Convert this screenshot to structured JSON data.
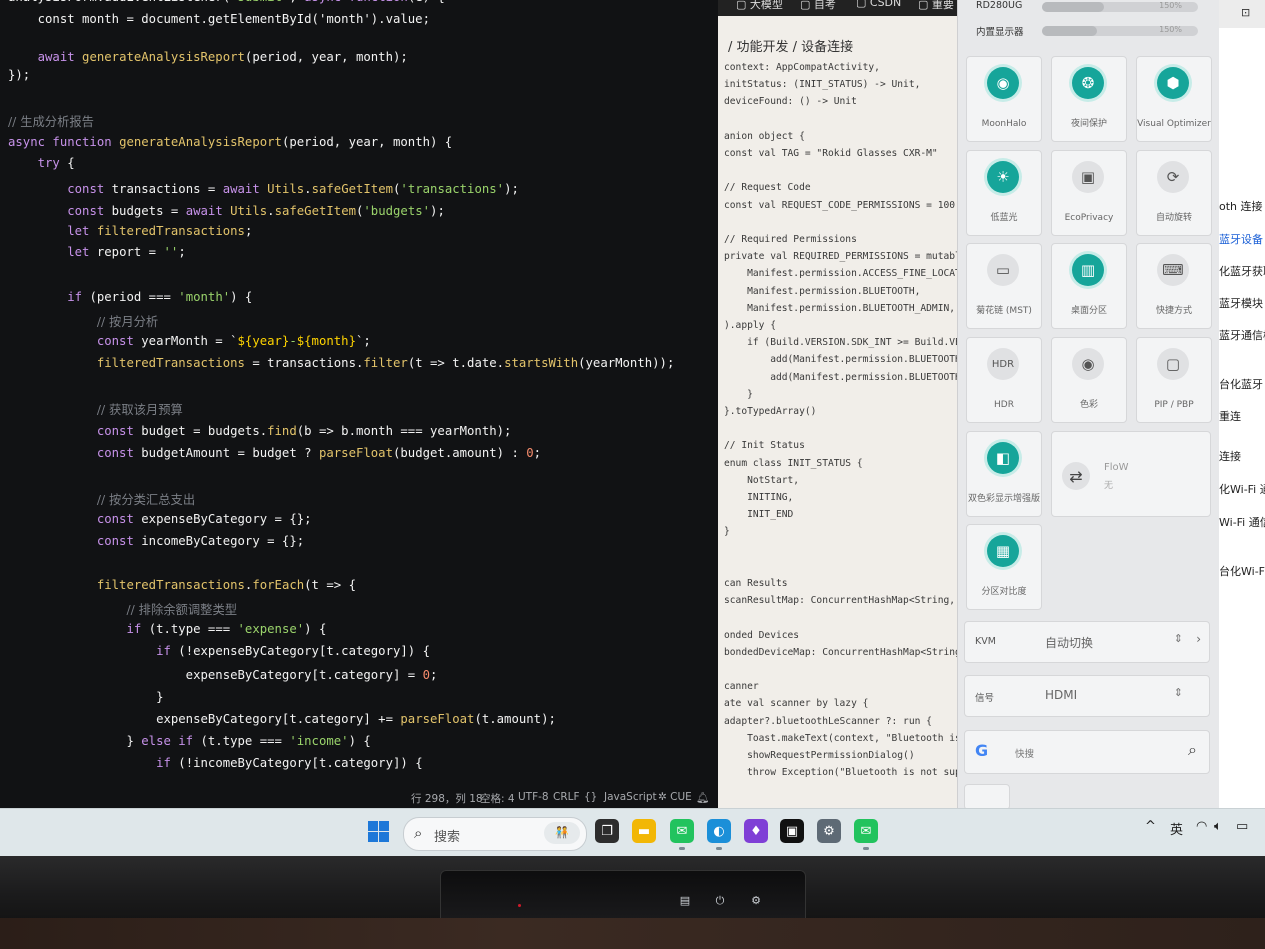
{
  "editor": {
    "lines": [
      {
        "tokens": [
          [
            "pr",
            "analysisForm.addEventListener("
          ],
          [
            "str",
            "'submit'"
          ],
          [
            "pr",
            ", "
          ],
          [
            "kw",
            "async function"
          ],
          [
            "pr",
            "(e) {"
          ]
        ]
      },
      {
        "tokens": [
          [
            "pr",
            "    const month = document.getElementById('month').value;"
          ]
        ]
      },
      {
        "tokens": []
      },
      {
        "tokens": [
          [
            "pr",
            "    "
          ],
          [
            "kw",
            "await "
          ],
          [
            "fn",
            "generateAnalysisReport"
          ],
          [
            "pr",
            "(period, year, month);"
          ]
        ]
      },
      {
        "tokens": [
          [
            "pr",
            "});"
          ]
        ]
      },
      {
        "tokens": []
      },
      {
        "tokens": [
          [
            "cm",
            "// 生成分析报告"
          ]
        ]
      },
      {
        "tokens": [
          [
            "kw",
            "async function "
          ],
          [
            "fn",
            "generateAnalysisReport"
          ],
          [
            "pr",
            "(period, year, month) {"
          ]
        ]
      },
      {
        "tokens": [
          [
            "pr",
            "    "
          ],
          [
            "kw",
            "try"
          ],
          [
            "pr",
            " {"
          ]
        ]
      },
      {
        "tokens": [
          [
            "pr",
            "        "
          ],
          [
            "kw",
            "const "
          ],
          [
            "pr",
            "transactions = "
          ],
          [
            "kw",
            "await "
          ],
          [
            "fn",
            "Utils"
          ],
          [
            "pr",
            "."
          ],
          [
            "fn",
            "safeGetItem"
          ],
          [
            "pr",
            "("
          ],
          [
            "str",
            "'transactions'"
          ],
          [
            "pr",
            ");"
          ]
        ]
      },
      {
        "tokens": [
          [
            "pr",
            "        "
          ],
          [
            "kw",
            "const "
          ],
          [
            "pr",
            "budgets = "
          ],
          [
            "kw",
            "await "
          ],
          [
            "fn",
            "Utils"
          ],
          [
            "pr",
            "."
          ],
          [
            "fn",
            "safeGetItem"
          ],
          [
            "pr",
            "("
          ],
          [
            "str",
            "'budgets'"
          ],
          [
            "pr",
            ");"
          ]
        ]
      },
      {
        "tokens": [
          [
            "pr",
            "        "
          ],
          [
            "kw",
            "let "
          ],
          [
            "fn",
            "filteredTransactions"
          ],
          [
            "pr",
            ";"
          ]
        ]
      },
      {
        "tokens": [
          [
            "pr",
            "        "
          ],
          [
            "kw",
            "let "
          ],
          [
            "pr",
            "report = "
          ],
          [
            "str",
            "''"
          ],
          [
            "pr",
            ";"
          ]
        ]
      },
      {
        "tokens": []
      },
      {
        "tokens": [
          [
            "pr",
            "        "
          ],
          [
            "kw",
            "if "
          ],
          [
            "pr",
            "(period === "
          ],
          [
            "str",
            "'month'"
          ],
          [
            "pr",
            ") {"
          ]
        ]
      },
      {
        "tokens": [
          [
            "pr",
            "            "
          ],
          [
            "cm",
            "// 按月分析"
          ]
        ]
      },
      {
        "tokens": [
          [
            "pr",
            "            "
          ],
          [
            "kw",
            "const "
          ],
          [
            "pr",
            "yearMonth = `"
          ],
          [
            "yb",
            "${year}"
          ],
          [
            "str",
            "-"
          ],
          [
            "yb",
            "${month}"
          ],
          [
            "pr",
            "`;"
          ]
        ]
      },
      {
        "tokens": [
          [
            "pr",
            "            "
          ],
          [
            "fn",
            "filteredTransactions"
          ],
          [
            "pr",
            " = transactions."
          ],
          [
            "fn",
            "filter"
          ],
          [
            "pr",
            "(t => t.date."
          ],
          [
            "fn",
            "startsWith"
          ],
          [
            "pr",
            "(yearMonth));"
          ]
        ]
      },
      {
        "tokens": []
      },
      {
        "tokens": [
          [
            "pr",
            "            "
          ],
          [
            "cm",
            "// 获取该月预算"
          ]
        ]
      },
      {
        "tokens": [
          [
            "pr",
            "            "
          ],
          [
            "kw",
            "const "
          ],
          [
            "pr",
            "budget = budgets."
          ],
          [
            "fn",
            "find"
          ],
          [
            "pr",
            "(b => b.month === yearMonth);"
          ]
        ]
      },
      {
        "tokens": [
          [
            "pr",
            "            "
          ],
          [
            "kw",
            "const "
          ],
          [
            "pr",
            "budgetAmount = budget ? "
          ],
          [
            "fn",
            "parseFloat"
          ],
          [
            "pr",
            "(budget.amount) : "
          ],
          [
            "nm",
            "0"
          ],
          [
            "pr",
            ";"
          ]
        ]
      },
      {
        "tokens": []
      },
      {
        "tokens": [
          [
            "pr",
            "            "
          ],
          [
            "cm",
            "// 按分类汇总支出"
          ]
        ]
      },
      {
        "tokens": [
          [
            "pr",
            "            "
          ],
          [
            "kw",
            "const "
          ],
          [
            "pr",
            "expenseByCategory = {};"
          ]
        ]
      },
      {
        "tokens": [
          [
            "pr",
            "            "
          ],
          [
            "kw",
            "const "
          ],
          [
            "pr",
            "incomeByCategory = {};"
          ]
        ]
      },
      {
        "tokens": []
      },
      {
        "tokens": [
          [
            "pr",
            "            "
          ],
          [
            "fn",
            "filteredTransactions"
          ],
          [
            "pr",
            "."
          ],
          [
            "fn",
            "forEach"
          ],
          [
            "pr",
            "(t => {"
          ]
        ]
      },
      {
        "tokens": [
          [
            "pr",
            "                "
          ],
          [
            "cm",
            "// 排除余额调整类型"
          ]
        ]
      },
      {
        "tokens": [
          [
            "pr",
            "                "
          ],
          [
            "kw",
            "if "
          ],
          [
            "pr",
            "(t.type === "
          ],
          [
            "str",
            "'expense'"
          ],
          [
            "pr",
            ") {"
          ]
        ]
      },
      {
        "tokens": [
          [
            "pr",
            "                    "
          ],
          [
            "kw",
            "if "
          ],
          [
            "pr",
            "(!expenseByCategory[t.category]) {"
          ]
        ]
      },
      {
        "tokens": [
          [
            "pr",
            "                        expenseByCategory[t.category] = "
          ],
          [
            "nm",
            "0"
          ],
          [
            "pr",
            ";"
          ]
        ]
      },
      {
        "tokens": [
          [
            "pr",
            "                    }"
          ]
        ]
      },
      {
        "tokens": [
          [
            "pr",
            "                    expenseByCategory[t.category] += "
          ],
          [
            "fn",
            "parseFloat"
          ],
          [
            "pr",
            "(t.amount);"
          ]
        ]
      },
      {
        "tokens": [
          [
            "pr",
            "                } "
          ],
          [
            "kw",
            "else if "
          ],
          [
            "pr",
            "(t.type === "
          ],
          [
            "str",
            "'income'"
          ],
          [
            "pr",
            ") {"
          ]
        ]
      },
      {
        "tokens": [
          [
            "pr",
            "                    "
          ],
          [
            "kw",
            "if "
          ],
          [
            "pr",
            "(!incomeByCategory[t.category]) {"
          ]
        ]
      }
    ],
    "status": [
      "行 298，列 18",
      "空格: 4",
      "UTF-8",
      "CRLF",
      "{}",
      "JavaScript",
      "CUE"
    ]
  },
  "doc": {
    "tabs": [
      "大模型",
      "自考",
      "CSDN",
      "重要"
    ],
    "breadcrumb": "/ 功能开发 / 设备连接",
    "lines": [
      "context: AppCompatActivity,",
      "initStatus: (INIT_STATUS) -> Unit,",
      "deviceFound: () -> Unit",
      "",
      "anion object {",
      "const val TAG = \"Rokid Glasses CXR-M\"",
      "",
      "// Request Code",
      "const val REQUEST_CODE_PERMISSIONS = 100",
      "",
      "// Required Permissions",
      "private val REQUIRED_PERMISSIONS = mutableL",
      "    Manifest.permission.ACCESS_FINE_LOCATION",
      "    Manifest.permission.BLUETOOTH,",
      "    Manifest.permission.BLUETOOTH_ADMIN,",
      ").apply {",
      "    if (Build.VERSION.SDK_INT >= Build.VERS",
      "        add(Manifest.permission.BLUETOOTH_S",
      "        add(Manifest.permission.BLUETOOTH_C",
      "    }",
      "}.toTypedArray()",
      "",
      "// Init Status",
      "enum class INIT_STATUS {",
      "    NotStart,",
      "    INITING,",
      "    INIT_END",
      "}",
      "",
      "",
      "can Results",
      "scanResultMap: ConcurrentHashMap<String, Bl",
      "",
      "onded Devices",
      "bondedDeviceMap: ConcurrentHashMap<String,",
      "",
      "canner",
      "ate val scanner by lazy {",
      "adapter?.bluetoothLeScanner ?: run {",
      "    Toast.makeText(context, \"Bluetooth is no",
      "    showRequestPermissionDialog()",
      "    throw Exception(\"Bluetooth is not suppor",
      ""
    ]
  },
  "panel": {
    "sliders": [
      {
        "label": "RD280UG",
        "percent": "150%",
        "level": 0.4
      },
      {
        "label": "内置显示器",
        "percent": "150%",
        "level": 0.35
      }
    ],
    "tiles": [
      {
        "label": "MoonHalo",
        "icon": "speaker-icon",
        "glyph": "◉",
        "active": true
      },
      {
        "label": "夜间保护",
        "icon": "owl-icon",
        "glyph": "❂",
        "active": true
      },
      {
        "label": "Visual Optimizer",
        "icon": "optimizer-icon",
        "glyph": "⬢",
        "active": true
      },
      {
        "label": "低蓝光",
        "icon": "bulb-icon",
        "glyph": "☀",
        "active": true
      },
      {
        "label": "EcoPrivacy",
        "icon": "privacy-icon",
        "glyph": "▣",
        "active": false
      },
      {
        "label": "自动旋转",
        "icon": "rotate-icon",
        "glyph": "⟳",
        "active": false
      },
      {
        "label": "菊花链 (MST)",
        "icon": "monitor-icon",
        "glyph": "▭",
        "active": false
      },
      {
        "label": "桌面分区",
        "icon": "split-icon",
        "glyph": "▥",
        "active": true
      },
      {
        "label": "快捷方式",
        "icon": "keyboard-icon",
        "glyph": "⌨",
        "active": false
      },
      {
        "label": "HDR",
        "icon": "hdr-icon",
        "glyph": "HDR",
        "active": false
      },
      {
        "label": "色彩",
        "icon": "eye-icon",
        "glyph": "◉",
        "active": false
      },
      {
        "label": "PIP / PBP",
        "icon": "pip-icon",
        "glyph": "▢",
        "active": false
      },
      {
        "label": "双色彩显示增强版",
        "icon": "color-enhance-icon",
        "glyph": "◧",
        "active": true
      }
    ],
    "flow": {
      "label": "FloW",
      "value": "无"
    },
    "contrast": {
      "label": "分区对比度",
      "icon": "contrast-icon",
      "glyph": "▦"
    },
    "kvm": {
      "key": "KVM",
      "value": "自动切换"
    },
    "signal": {
      "key": "信号",
      "value": "HDMI"
    },
    "search": {
      "placeholder": "快搜"
    }
  },
  "rwin": {
    "items": [
      {
        "text": "oth 连接",
        "selected": false
      },
      {
        "text": "蓝牙设备",
        "selected": true
      },
      {
        "text": "化蓝牙获取",
        "selected": false
      },
      {
        "text": "蓝牙模块",
        "selected": false
      },
      {
        "text": "蓝牙通信模",
        "selected": false
      },
      {
        "text": "台化蓝牙",
        "selected": false
      },
      {
        "text": "重连",
        "selected": false
      },
      {
        "text": "连接",
        "selected": false
      },
      {
        "text": "化Wi-Fi 通信",
        "selected": false
      },
      {
        "text": "Wi-Fi 通信",
        "selected": false
      },
      {
        "text": "台化Wi-Fi 通",
        "selected": false
      }
    ]
  },
  "taskbar": {
    "search_placeholder": "搜索",
    "apps": [
      {
        "name": "task-view-icon",
        "color": "#2d2d2d",
        "glyph": "❐"
      },
      {
        "name": "file-explorer-icon",
        "color": "#f2b705",
        "glyph": "▬"
      },
      {
        "name": "wechat-icon",
        "color": "#22c35e",
        "glyph": "✉"
      },
      {
        "name": "edge-icon",
        "color": "#1b8fd8",
        "glyph": "◐"
      },
      {
        "name": "app-purple-icon",
        "color": "#7f3fd6",
        "glyph": "♦"
      },
      {
        "name": "app-green-terminal-icon",
        "color": "#111111",
        "glyph": "▣"
      },
      {
        "name": "settings-icon",
        "color": "#5e6a75",
        "glyph": "⚙"
      },
      {
        "name": "wechat-2-icon",
        "color": "#22c35e",
        "glyph": "✉"
      }
    ],
    "ime": "英"
  }
}
